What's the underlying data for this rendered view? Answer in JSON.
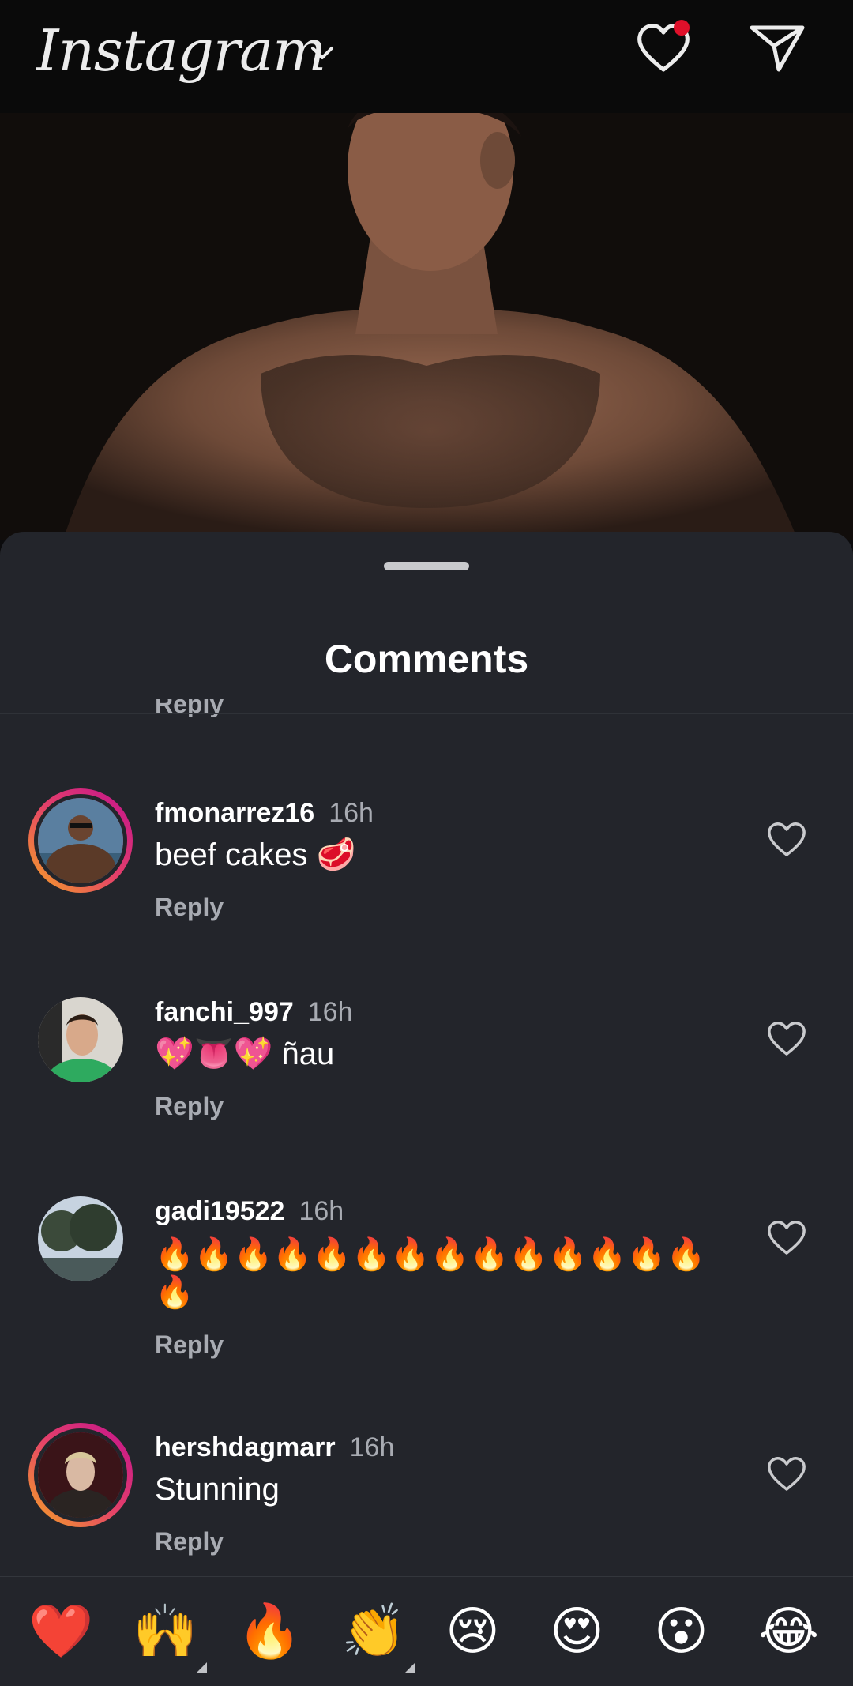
{
  "header": {
    "logo_text": "Instagram",
    "has_notification": true
  },
  "sheet": {
    "title": "Comments",
    "partial_reply": "Reply"
  },
  "comments": [
    {
      "username": "fmonarrez16",
      "time": "16h",
      "text": "beef cakes 🥩",
      "reply": "Reply",
      "story_ring": true
    },
    {
      "username": "fanchi_997",
      "time": "16h",
      "text": "💖👅💖 ñau",
      "reply": "Reply",
      "story_ring": false
    },
    {
      "username": "gadi19522",
      "time": "16h",
      "text": "🔥🔥🔥🔥🔥🔥🔥🔥🔥🔥🔥🔥🔥🔥🔥",
      "reply": "Reply",
      "story_ring": false
    },
    {
      "username": "hershdagmarr",
      "time": "16h",
      "text": "Stunning",
      "reply": "Reply",
      "story_ring": true
    }
  ],
  "quick_emojis": [
    "❤️",
    "🙌",
    "🔥",
    "👏",
    "😢",
    "😍",
    "😮",
    "😂"
  ],
  "colors": {
    "sheet_bg": "#23252b",
    "secondary_text": "#a8abb2",
    "notification": "#e0102a"
  }
}
